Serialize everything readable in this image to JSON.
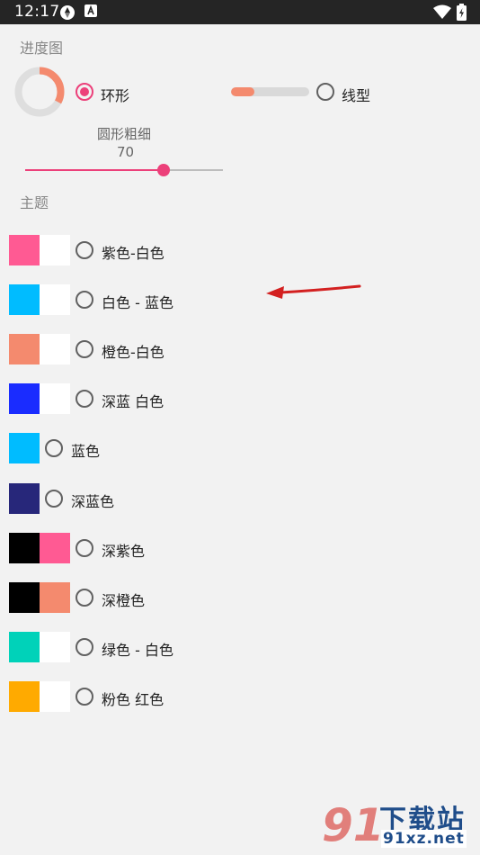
{
  "status_bar": {
    "time": "12:17"
  },
  "progress": {
    "section_title": "进度图",
    "ring_option": {
      "label": "环形",
      "selected": true
    },
    "linear_option": {
      "label": "线型",
      "selected": false
    },
    "ring_progress_fraction": 0.33,
    "linear_progress_fraction": 0.3,
    "thickness_label": "圆形粗细",
    "thickness_value": "70",
    "slider_fraction": 0.7
  },
  "theme": {
    "section_title": "主题",
    "items": [
      {
        "label": "紫色-白色",
        "colors": [
          "#ff5a93",
          "#ffffff"
        ],
        "selected": false
      },
      {
        "label": "白色 - 蓝色",
        "colors": [
          "#00bcff",
          "#ffffff"
        ],
        "selected": false
      },
      {
        "label": "橙色-白色",
        "colors": [
          "#f48a6e",
          "#ffffff"
        ],
        "selected": false
      },
      {
        "label": "深蓝 白色",
        "colors": [
          "#1a2cff",
          "#ffffff"
        ],
        "selected": false
      },
      {
        "label": "蓝色",
        "colors": [
          "#00bcff"
        ],
        "selected": false
      },
      {
        "label": "深蓝色",
        "colors": [
          "#27277a"
        ],
        "selected": false
      },
      {
        "label": "深紫色",
        "colors": [
          "#000000",
          "#ff5a93"
        ],
        "selected": false
      },
      {
        "label": "深橙色",
        "colors": [
          "#000000",
          "#f48a6e"
        ],
        "selected": false
      },
      {
        "label": "绿色 - 白色",
        "colors": [
          "#00d2b9",
          "#ffffff"
        ],
        "selected": false
      },
      {
        "label": "粉色 红色",
        "colors": [
          "#ffaa00",
          "#ffffff"
        ],
        "selected": false
      }
    ]
  },
  "accent_color": "#ec407a",
  "watermark": {
    "number": "91",
    "title": "下载站",
    "domain": "91xz.net"
  }
}
